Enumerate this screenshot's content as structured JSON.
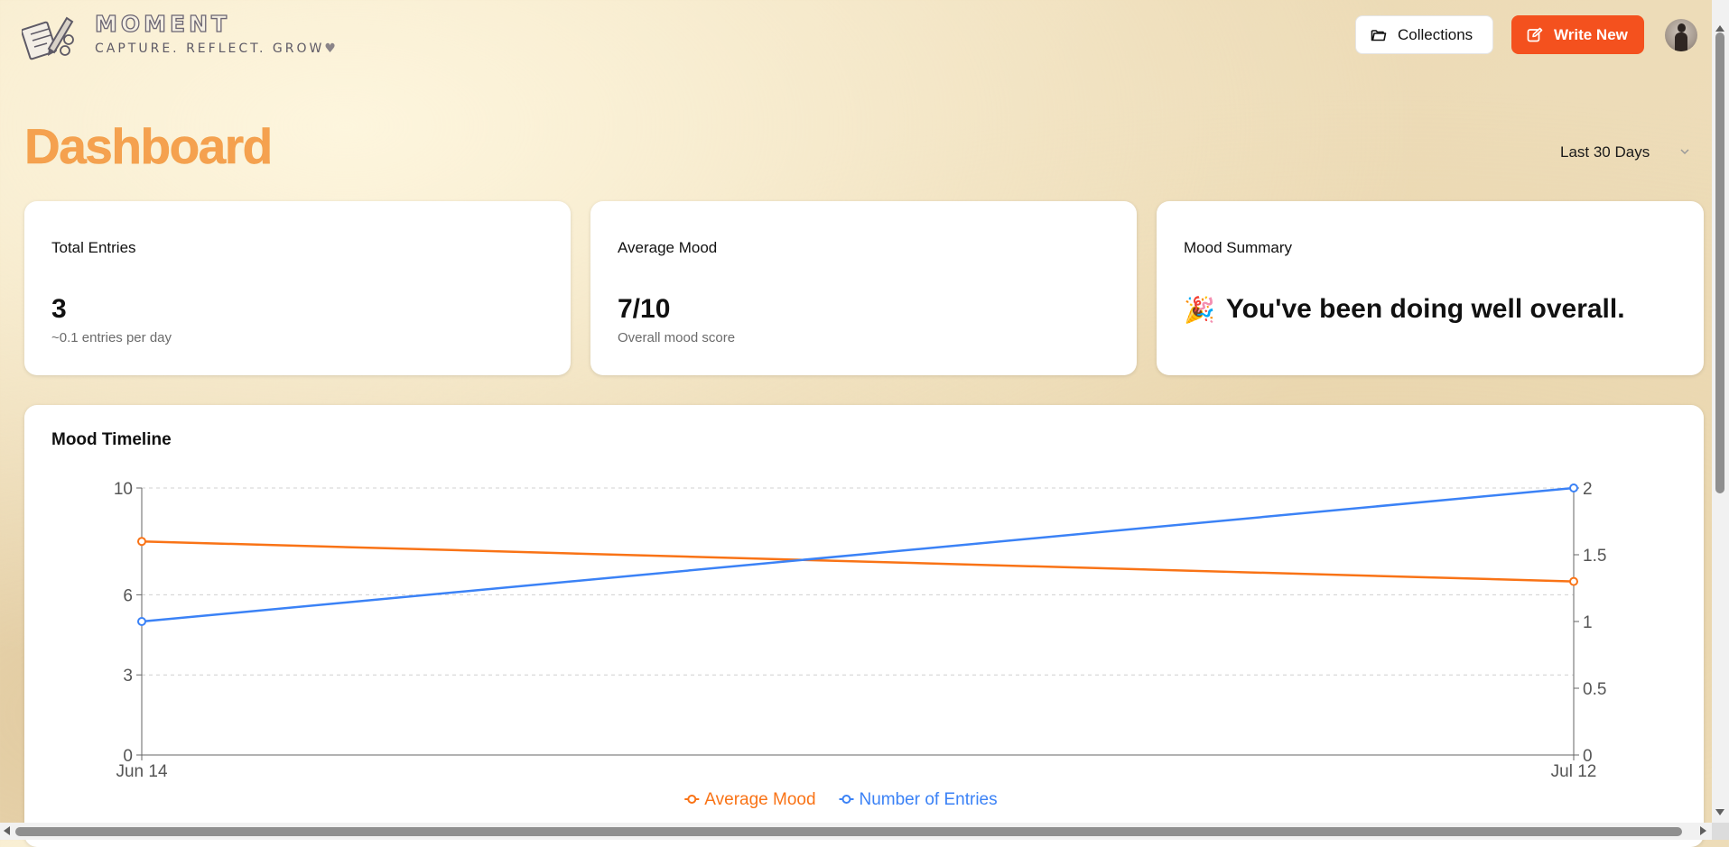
{
  "brand": {
    "name": "MOMENT",
    "tagline": "CAPTURE. REFLECT. GROW",
    "tagline_icon": "heart-icon",
    "logo_icon": "notebook-pencil-logo"
  },
  "header": {
    "collections_label": "Collections",
    "collections_icon": "folder-icon",
    "write_new_label": "Write New",
    "write_new_icon": "edit-icon",
    "accent_color": "#f4511e",
    "avatar_icon": "user-avatar"
  },
  "page": {
    "title": "Dashboard",
    "title_color": "#f5a14f",
    "date_range": {
      "selected": "Last 30 Days",
      "icon": "chevron-down-icon"
    }
  },
  "stats": {
    "total_entries": {
      "label": "Total Entries",
      "value": "3",
      "sub": "~0.1 entries per day"
    },
    "average_mood": {
      "label": "Average Mood",
      "value": "7/10",
      "sub": "Overall mood score"
    },
    "mood_summary": {
      "label": "Mood Summary",
      "emoji": "🎉",
      "text": "You've been doing well overall."
    }
  },
  "chart": {
    "title": "Mood Timeline"
  },
  "chart_data": {
    "type": "line",
    "title": "Mood Timeline",
    "x": [
      "Jun 14",
      "Jul 12"
    ],
    "series": [
      {
        "name": "Average Mood",
        "axis": "left",
        "color": "#f97316",
        "values": [
          8,
          6.5
        ]
      },
      {
        "name": "Number of Entries",
        "axis": "right",
        "color": "#3b82f6",
        "values": [
          1,
          2
        ]
      }
    ],
    "y_left": {
      "ticks": [
        0,
        3,
        6,
        10
      ],
      "ylim": [
        0,
        10
      ]
    },
    "y_right": {
      "ticks": [
        0,
        0.5,
        1,
        1.5,
        2
      ],
      "ylim": [
        0,
        2
      ]
    },
    "grid": true,
    "legend_position": "bottom-center"
  }
}
